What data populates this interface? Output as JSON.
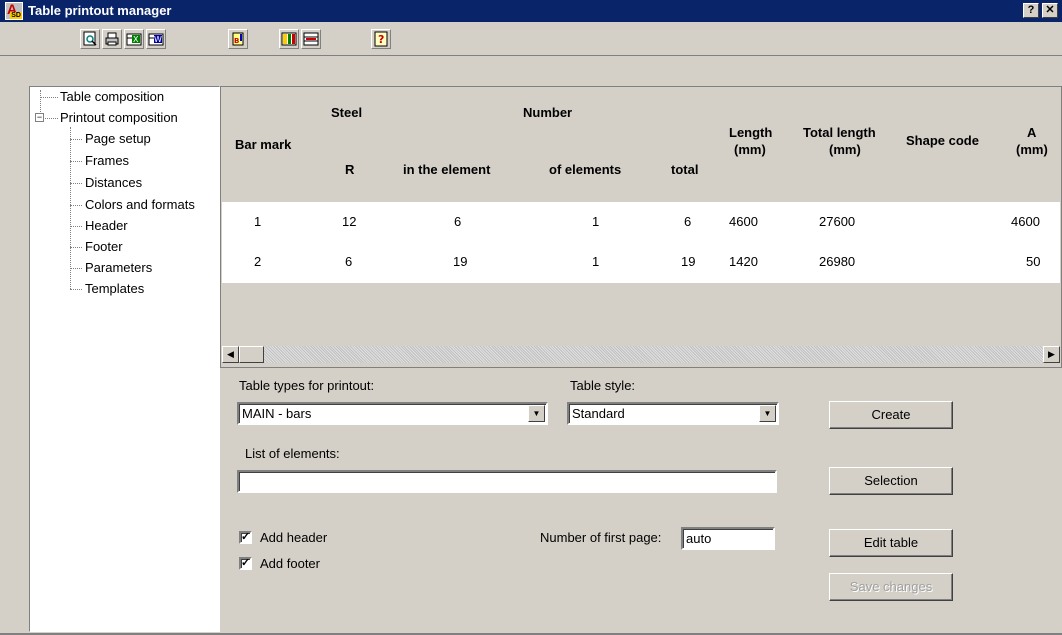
{
  "window": {
    "title": "Table printout manager",
    "help_btn": "?",
    "close_btn": "✕"
  },
  "toolbar": {
    "icons": [
      "print-preview-icon",
      "print-icon",
      "export-excel-icon",
      "export-word-icon",
      "import-icon",
      "table-format-icon",
      "column-width-icon",
      "help-icon"
    ]
  },
  "tree": {
    "items": [
      {
        "label": "Table composition"
      },
      {
        "label": "Printout composition"
      },
      {
        "label": "Page setup"
      },
      {
        "label": "Frames"
      },
      {
        "label": "Distances"
      },
      {
        "label": "Colors and formats"
      },
      {
        "label": "Header"
      },
      {
        "label": "Footer"
      },
      {
        "label": "Parameters"
      },
      {
        "label": "Templates"
      }
    ],
    "expander": "−"
  },
  "table": {
    "group_steel": "Steel",
    "group_number": "Number",
    "headers": {
      "bar_mark": "Bar mark",
      "r": "R",
      "in_element": "in the element",
      "of_elements": "of elements",
      "total": "total",
      "length": "Length",
      "length_unit": "(mm)",
      "total_length": "Total length",
      "total_length_unit": "(mm)",
      "shape_code": "Shape code",
      "a": "A",
      "a_unit": "(mm)"
    },
    "rows": [
      {
        "bar_mark": "1",
        "r": "12",
        "in_element": "6",
        "of_elements": "1",
        "total": "6",
        "length": "4600",
        "total_length": "27600",
        "shape_code": "",
        "a": "4600"
      },
      {
        "bar_mark": "2",
        "r": "6",
        "in_element": "19",
        "of_elements": "1",
        "total": "19",
        "length": "1420",
        "total_length": "26980",
        "shape_code": "",
        "a": "50"
      }
    ]
  },
  "form": {
    "table_types_label": "Table types for printout:",
    "table_types_value": "MAIN - bars",
    "table_style_label": "Table style:",
    "table_style_value": "Standard",
    "list_elements_label": "List of elements:",
    "list_elements_value": "",
    "add_header_label": "Add header",
    "add_header_checked": true,
    "add_footer_label": "Add footer",
    "add_footer_checked": true,
    "first_page_label": "Number of first page:",
    "first_page_value": "auto",
    "check_mark": "✓"
  },
  "buttons": {
    "create": "Create",
    "selection": "Selection",
    "edit_table": "Edit table",
    "save_changes": "Save changes"
  },
  "colors": {
    "title_bar": "#0a246a",
    "face": "#d4d0c8"
  }
}
